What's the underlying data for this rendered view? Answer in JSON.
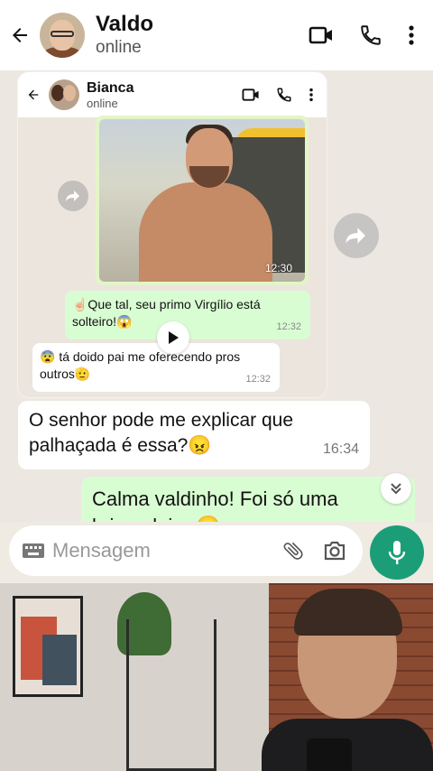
{
  "header": {
    "name": "Valdo",
    "status": "online",
    "icons": [
      "back-arrow-icon",
      "video-call-icon",
      "phone-icon",
      "more-vert-icon"
    ]
  },
  "embedded_chat": {
    "name": "Bianca",
    "status": "online",
    "photo_time": "12:30",
    "msg_out_text": "☝🏻Que tal, seu primo Virgílio está solteiro!😱",
    "msg_out_time": "12:32",
    "msg_in_text": "😨 tá doido pai me oferecendo pros outros🫡",
    "msg_in_time": "12:32"
  },
  "messages": {
    "incoming_text": "O senhor pode me explicar que palhaçada é essa?😠",
    "incoming_time": "16:34",
    "outgoing_text": "Calma valdinho! Foi só uma brincadeira 😊"
  },
  "input": {
    "placeholder": "Mensagem"
  },
  "colors": {
    "accent": "#1b9e77",
    "outgoing_bubble": "#d9fdd3",
    "background": "#ece7e0"
  }
}
